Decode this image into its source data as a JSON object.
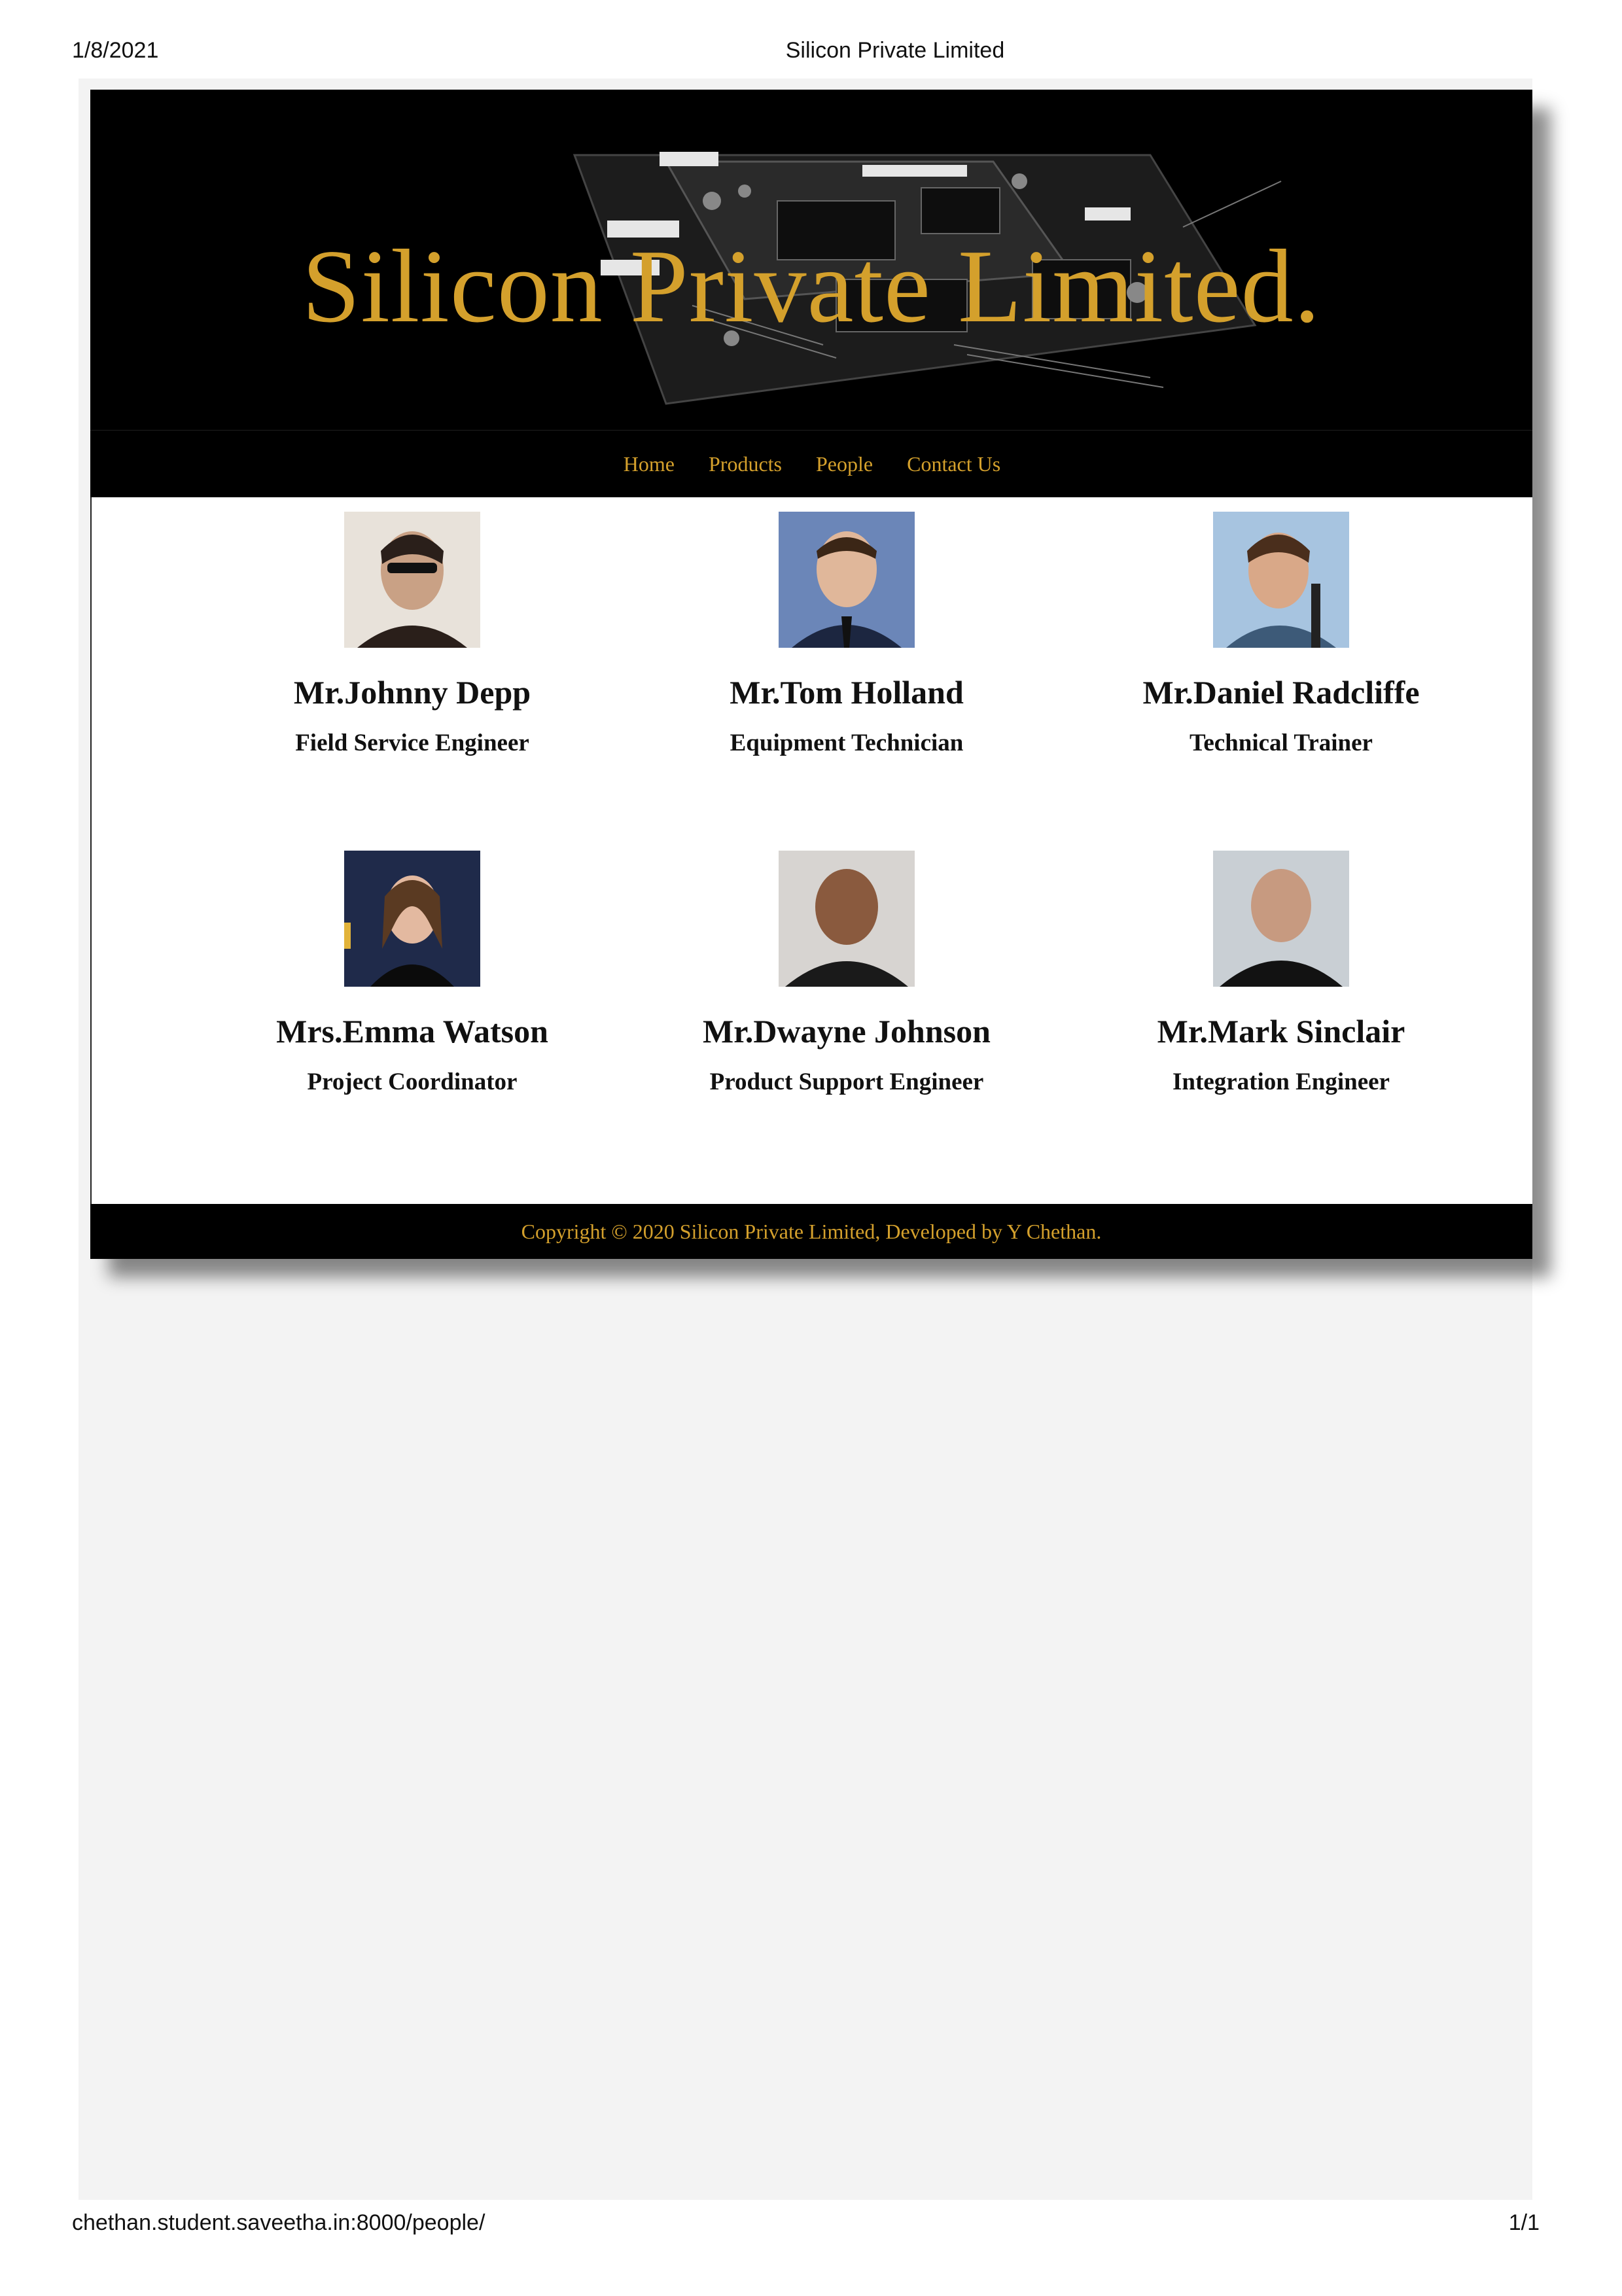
{
  "print_header": {
    "date": "1/8/2021",
    "title": "Silicon Private Limited"
  },
  "print_footer": {
    "url": "chethan.student.saveetha.in:8000/people/",
    "page": "1/1"
  },
  "banner": {
    "title": "Silicon Private Limited."
  },
  "nav": {
    "items": [
      {
        "label": "Home"
      },
      {
        "label": "Products"
      },
      {
        "label": "People"
      },
      {
        "label": "Contact Us"
      }
    ]
  },
  "people": [
    {
      "name": "Mr.Johnny Depp",
      "role": "Field Service Engineer",
      "photo_bg": "#e8e2da",
      "photo_fg": "#2a1f1a"
    },
    {
      "name": "Mr.Tom Holland",
      "role": "Equipment Technician",
      "photo_bg": "#6b86b8",
      "photo_fg": "#1c2640"
    },
    {
      "name": "Mr.Daniel Radcliffe",
      "role": "Technical Trainer",
      "photo_bg": "#a7c4e0",
      "photo_fg": "#3d5a78"
    },
    {
      "name": "Mrs.Emma Watson",
      "role": "Project Coordinator",
      "photo_bg": "#1f2a4a",
      "photo_fg": "#0b0b0b"
    },
    {
      "name": "Mr.Dwayne Johnson",
      "role": "Product Support Engineer",
      "photo_bg": "#d7d4d1",
      "photo_fg": "#1a1a1a"
    },
    {
      "name": "Mr.Mark Sinclair",
      "role": "Integration Engineer",
      "photo_bg": "#c9cfd4",
      "photo_fg": "#121212"
    }
  ],
  "footer": {
    "copyright": "Copyright © 2020 Silicon Private Limited, Developed by Y Chethan."
  },
  "colors": {
    "accent_gold": "#d4a02c",
    "header_bg": "#000000",
    "page_bg": "#f3f3f3"
  }
}
